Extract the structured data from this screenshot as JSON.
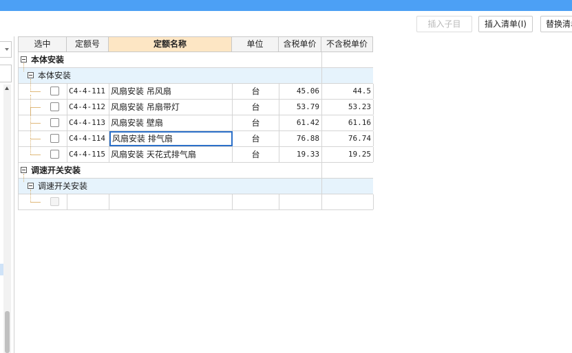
{
  "toolbar": {
    "insert_child": "插入子目",
    "insert_list": "插入清单(I)",
    "replace_list": "替换清单"
  },
  "grid": {
    "headers": {
      "select": "选中",
      "code": "定额号",
      "name": "定额名称",
      "unit": "单位",
      "price_tax": "含税单价",
      "price_notax": "不含税单价"
    },
    "group1": {
      "title": "本体安装",
      "sub_title": "本体安装",
      "rows": [
        {
          "code": "C4-4-111",
          "name": "风扇安装 吊风扇",
          "unit": "台",
          "price_tax": "45.06",
          "price_notax": "44.5"
        },
        {
          "code": "C4-4-112",
          "name": "风扇安装 吊扇带灯",
          "unit": "台",
          "price_tax": "53.79",
          "price_notax": "53.23"
        },
        {
          "code": "C4-4-113",
          "name": "风扇安装 壁扇",
          "unit": "台",
          "price_tax": "61.42",
          "price_notax": "61.16"
        },
        {
          "code": "C4-4-114",
          "name": "风扇安装 排气扇",
          "unit": "台",
          "price_tax": "76.88",
          "price_notax": "76.74"
        },
        {
          "code": "C4-4-115",
          "name": "风扇安装 天花式排气扇",
          "unit": "台",
          "price_tax": "19.33",
          "price_notax": "19.25"
        }
      ]
    },
    "group2": {
      "title": "调速开关安装",
      "sub_title": "调速开关安装"
    }
  }
}
